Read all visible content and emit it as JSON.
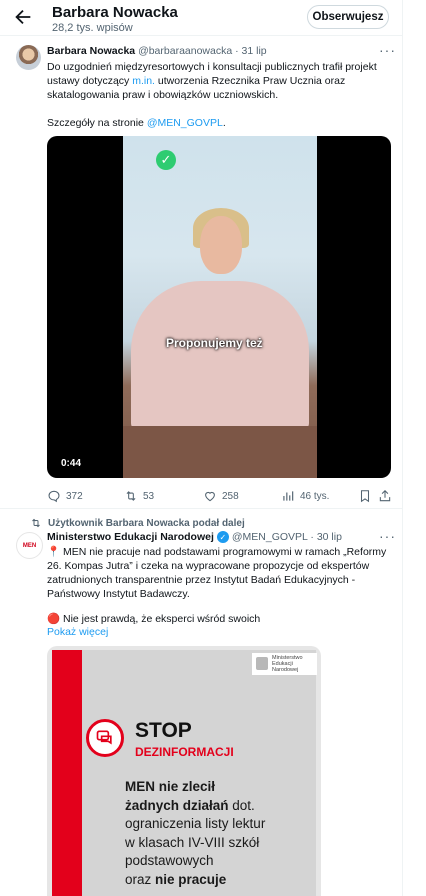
{
  "header": {
    "title": "Barbara Nowacka",
    "subtitle": "28,2 tys. wpisów",
    "follow_label": "Obserwujesz"
  },
  "tweet1": {
    "author": "Barbara Nowacka",
    "handle_date": "@barbaraanowacka · 31 lip",
    "more": "···",
    "line1": "Do uzgodnień międzyresortowych i konsultacji publicznych trafił projekt",
    "line2_pre": "ustawy dotyczący ",
    "line2_link": "m.in.",
    "line2_post": " utworzenia Rzecznika Praw Ucznia oraz",
    "line3": "skatalogowania praw i obowiązków uczniowskich.",
    "line4_pre": "Szczegóły na stronie ",
    "line4_link": "@MEN_GOVPL",
    "line4_post": ".",
    "video": {
      "caption": "Proponujemy też",
      "time": "0:44"
    },
    "stats": {
      "replies": "372",
      "retweets": "53",
      "likes": "258",
      "views": "46 tys."
    }
  },
  "tweet2": {
    "repost_label": "Użytkownik Barbara Nowacka podał dalej",
    "author": "Ministerstwo Edukacji Narodowej",
    "handle_date": "@MEN_GOVPL · 30 lip",
    "more": "···",
    "avatar_text": "MEN",
    "line1": "📍 MEN nie pracuje nad podstawami programowymi w ramach „Reformy",
    "line2": "26. Kompas Jutra” i czeka na wypracowane propozycje od ekspertów",
    "line3": "zatrudnionych transparentnie przez Instytut Badań Edukacyjnych -",
    "line4": "Państwowy Instytut Badawczy.",
    "line5": "🔴 Nie jest prawdą, że eksperci wśród swoich",
    "show_more": "Pokaż więcej",
    "poster": {
      "logo_line1": "Ministerstwo",
      "logo_line2": "Edukacji Narodowej",
      "title": "STOP",
      "subtitle": "DEZINFORMACJI",
      "bold1": "MEN nie zlecił",
      "bold2": "żadnych działań",
      "text2b": " dot.",
      "text3": "ograniczenia listy lektur",
      "text4": "w klasach IV-VIII szkół",
      "text5": "podstawowych",
      "text6a": "oraz ",
      "text6b": "nie pracuje"
    }
  },
  "colors": {
    "accent": "#1d9bf0",
    "muted": "#536471",
    "poster_red": "#e3001b"
  }
}
